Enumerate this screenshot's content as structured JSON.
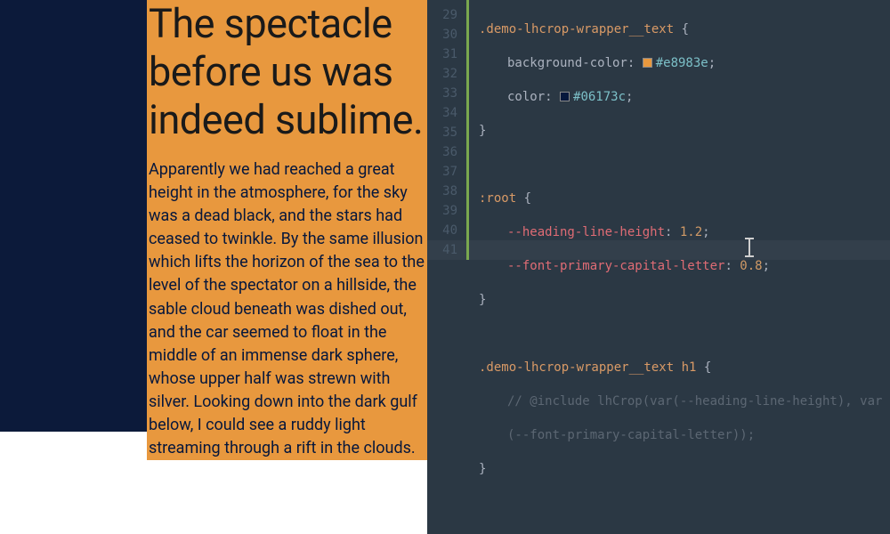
{
  "preview": {
    "heading": "The spectacle before us was indeed sublime.",
    "paragraph": "Apparently we had reached a great height in the atmosphere, for the sky was a dead black, and the stars had ceased to twinkle. By the same illusion which lifts the horizon of the sea to the level of the spectator on a hillside, the sable cloud beneath was dished out, and the car seemed to float in the middle of an immense dark sphere, whose upper half was strewn with silver. Looking down into the dark gulf below, I could see a ruddy light streaming through a rift in the clouds.",
    "bg_color": "#e8983e",
    "text_color": "#06173c"
  },
  "editor": {
    "line_start": 29,
    "line_end": 41,
    "code": {
      "l29_selector": ".demo-lhcrop-wrapper__text",
      "l29_open": " {",
      "l30_prop": "background-color",
      "l30_val": "#e8983e",
      "l31_prop": "color",
      "l31_val": "#06173c",
      "l32": "}",
      "l34_selector": ":root",
      "l34_open": " {",
      "l35_var": "--heading-line-height",
      "l35_val": "1.2",
      "l36_var": "--font-primary-capital-letter",
      "l36_val": "0.8",
      "l37": "}",
      "l39_selector": ".demo-lhcrop-wrapper__text h1",
      "l39_open": " {",
      "l40_comment_a": "// @include lhCrop(var(--heading-line-height), var",
      "l40_comment_b": "(--font-primary-capital-letter));",
      "l41": "}"
    }
  }
}
